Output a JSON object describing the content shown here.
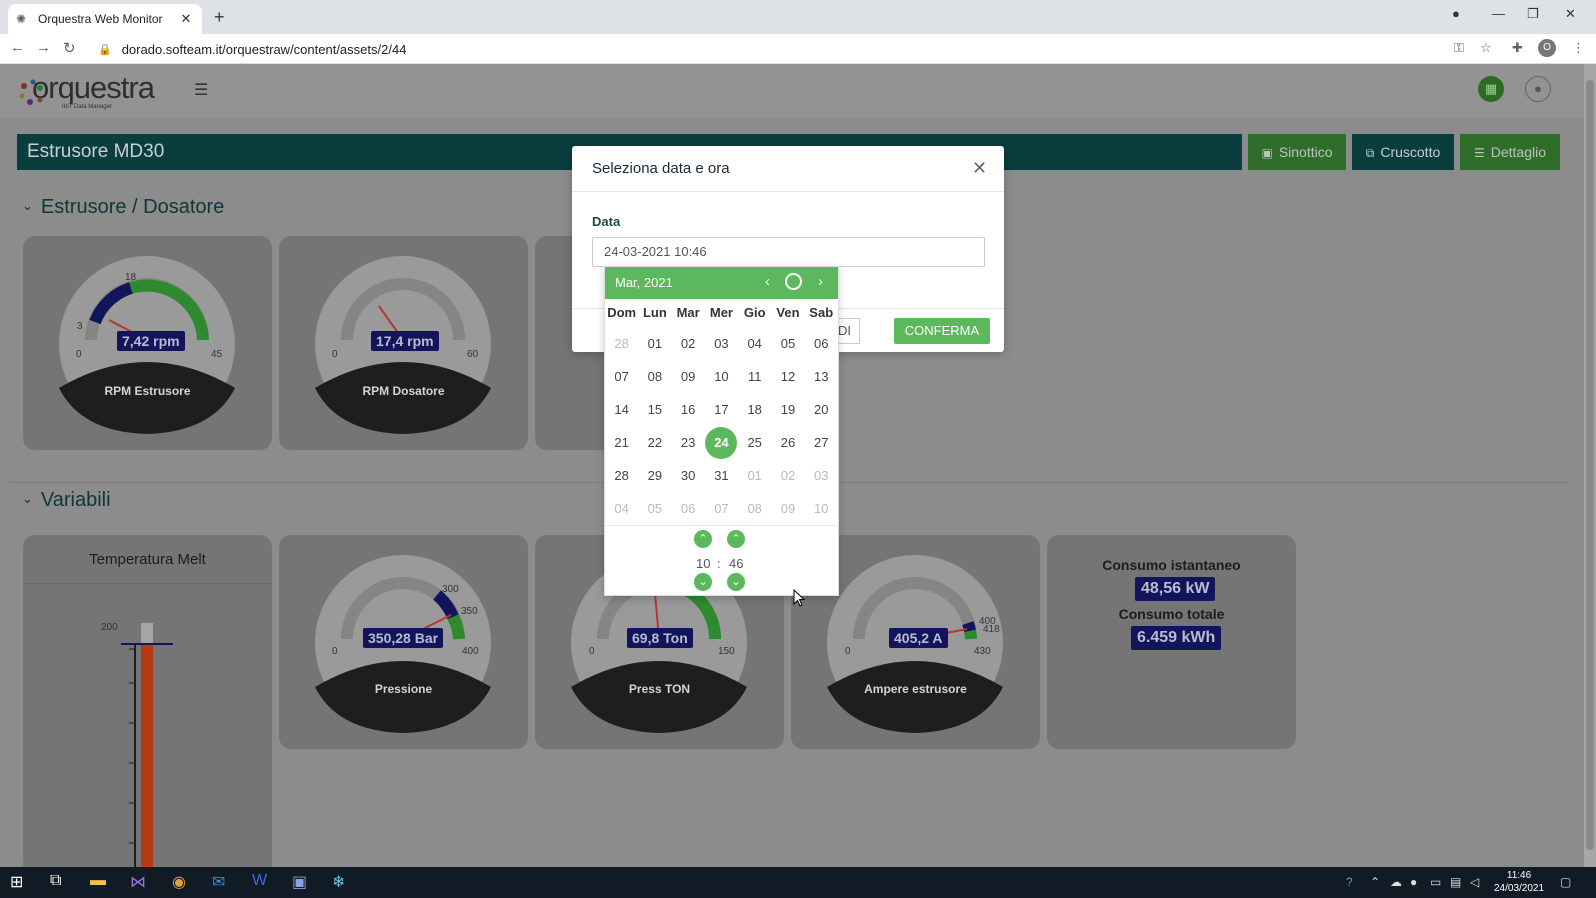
{
  "browser": {
    "tab_title": "Orquestra Web Monitor",
    "url": "dorado.softeam.it/orquestraw/content/assets/2/44",
    "profile_initial": "O"
  },
  "app": {
    "logo_text": "orquestra",
    "logo_subtext": "IIoT Data Manager",
    "page_title": "Estrusore MD30",
    "views": [
      {
        "label": "Sinottico",
        "icon": "image-icon"
      },
      {
        "label": "Cruscotto",
        "icon": "copy-icon"
      },
      {
        "label": "Dettaglio",
        "icon": "list-icon"
      }
    ],
    "sections": [
      {
        "title": "Estrusore / Dosatore"
      },
      {
        "title": "Variabili"
      }
    ],
    "gauges_top": [
      {
        "label": "RPM Estrusore",
        "value": "7,42 rpm",
        "min": "0",
        "max": "45",
        "marker": "18",
        "marker2": "3"
      },
      {
        "label": "RPM Dosatore",
        "value": "17,4 rpm",
        "min": "0",
        "max": "60"
      }
    ],
    "gauges_bottom": [
      {
        "label": "Pressione",
        "value": "350,28 Bar",
        "min": "0",
        "max": "400",
        "m1": "300",
        "m2": "350"
      },
      {
        "label": "Press TON",
        "value": "69,8 Ton",
        "min": "0",
        "max": "150"
      },
      {
        "label": "Ampere estrusore",
        "value": "405,2 A",
        "min": "0",
        "max": "430",
        "m1": "400",
        "m2": "418"
      }
    ],
    "melt": {
      "title": "Temperatura Melt",
      "scale_top": "200"
    },
    "consumo": {
      "istantaneo_label": "Consumo istantaneo",
      "istantaneo_value": "48,56 kW",
      "totale_label": "Consumo totale",
      "totale_value": "6.459 kWh"
    }
  },
  "modal": {
    "title": "Seleziona data e ora",
    "field_label": "Data",
    "field_value": "24-03-2021 10:46",
    "close_label": "HIUDI",
    "confirm_label": "CONFERMA"
  },
  "calendar": {
    "month": "Mar, 2021",
    "weekdays": [
      "Dom",
      "Lun",
      "Mar",
      "Mer",
      "Gio",
      "Ven",
      "Sab"
    ],
    "weeks": [
      [
        "28",
        "01",
        "02",
        "03",
        "04",
        "05",
        "06"
      ],
      [
        "07",
        "08",
        "09",
        "10",
        "11",
        "12",
        "13"
      ],
      [
        "14",
        "15",
        "16",
        "17",
        "18",
        "19",
        "20"
      ],
      [
        "21",
        "22",
        "23",
        "24",
        "25",
        "26",
        "27"
      ],
      [
        "28",
        "29",
        "30",
        "31",
        "01",
        "02",
        "03"
      ],
      [
        "04",
        "05",
        "06",
        "07",
        "08",
        "09",
        "10"
      ]
    ],
    "selected": "24",
    "hour": "10",
    "minute": "46",
    "separator": ":"
  },
  "taskbar": {
    "time": "11:46",
    "date": "24/03/2021"
  },
  "colors": {
    "accent": "#5cb85c",
    "title_bar": "#0a3e3e",
    "value_badge": "#13155c"
  }
}
